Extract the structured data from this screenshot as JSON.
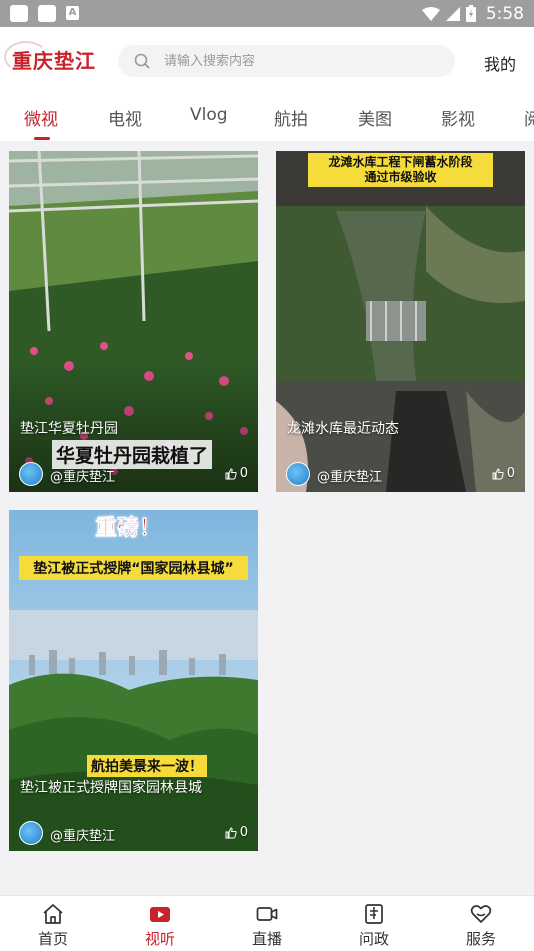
{
  "status_bar": {
    "time": "5:58"
  },
  "header": {
    "logo": "重庆垫江",
    "search_placeholder": "请输入搜索内容",
    "mine": "我的"
  },
  "tabs": [
    {
      "label": "微视",
      "active": true
    },
    {
      "label": "电视"
    },
    {
      "label": "Vlog"
    },
    {
      "label": "航拍"
    },
    {
      "label": "美图"
    },
    {
      "label": "影视"
    },
    {
      "label": "阅"
    }
  ],
  "cards": [
    {
      "title": "垫江华夏牡丹园",
      "author": "@重庆垫江",
      "likes": "0",
      "banner": "华夏牡丹园栽植了"
    },
    {
      "title": "龙滩水库最近动态",
      "author": "@重庆垫江",
      "likes": "0",
      "banner": "龙滩水库工程下闸蓄水阶段\n通过市级验收"
    },
    {
      "title": "垫江被正式授牌国家园林县城",
      "author": "@重庆垫江",
      "likes": "0",
      "banner_top": "重磅！",
      "banner_mid": "垫江被正式授牌“国家园林县城”",
      "banner_bottom": "航拍美景来一波！"
    }
  ],
  "bottom_nav": [
    {
      "label": "首页",
      "icon": "home-icon"
    },
    {
      "label": "视听",
      "icon": "video-play-icon",
      "active": true
    },
    {
      "label": "直播",
      "icon": "live-camera-icon"
    },
    {
      "label": "问政",
      "icon": "report-icon"
    },
    {
      "label": "服务",
      "icon": "heart-service-icon"
    }
  ],
  "colors": {
    "accent": "#c8222c",
    "banner_yellow": "#f5dc3a"
  }
}
